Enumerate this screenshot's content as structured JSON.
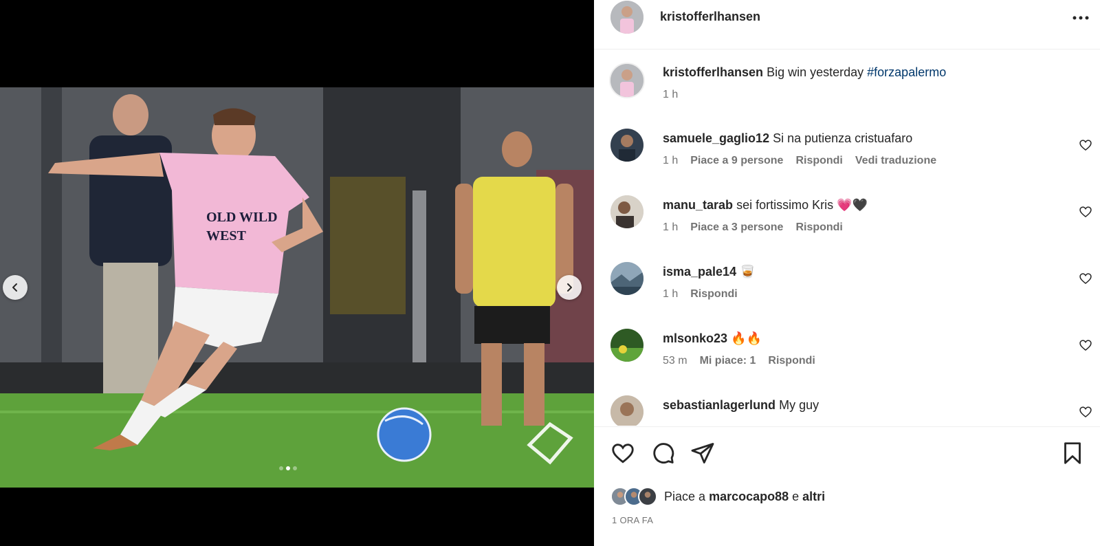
{
  "post": {
    "username": "kristofferlhansen",
    "caption": "Big win yesterday",
    "hashtag": "#forzapalermo",
    "caption_time": "1 h",
    "carousel": {
      "slide_count": 3,
      "active_slide": 2
    }
  },
  "comments": [
    {
      "username": "samuele_gaglio12",
      "text": "Si na putienza cristuafaro",
      "time": "1 h",
      "likes": "Piace a 9 persone",
      "reply": "Rispondi",
      "translate": "Vedi traduzione"
    },
    {
      "username": "manu_tarab",
      "text": "sei fortissimo Kris 💗🖤",
      "time": "1 h",
      "likes": "Piace a 3 persone",
      "reply": "Rispondi"
    },
    {
      "username": "isma_pale14",
      "text": "🥃",
      "time": "1 h",
      "reply": "Rispondi"
    },
    {
      "username": "mlsonko23",
      "text": "🔥🔥",
      "time": "53 m",
      "likes": "Mi piace: 1",
      "reply": "Rispondi"
    },
    {
      "username": "sebastianlagerlund",
      "text": "My guy"
    }
  ],
  "likes": {
    "prefix": "Piace a",
    "user": "marcocapo88",
    "joiner": "e",
    "others": "altri"
  },
  "timestamp": "1 ORA FA",
  "icons": {
    "more": "more-horizontal-icon",
    "like": "heart-icon",
    "comment": "comment-bubble-icon",
    "share": "paper-plane-icon",
    "save": "bookmark-icon",
    "prev": "chevron-left-icon",
    "next": "chevron-right-icon"
  },
  "colors": {
    "link": "#00376b",
    "muted": "#737373",
    "text": "#262626",
    "divider": "#efefef"
  }
}
